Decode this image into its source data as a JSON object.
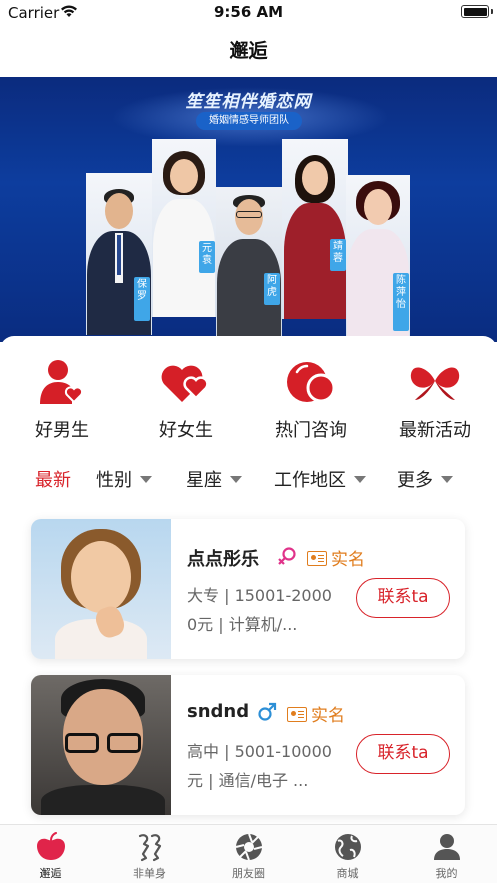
{
  "status_bar": {
    "carrier": "Carrier",
    "time": "9:56 AM"
  },
  "nav": {
    "title": "邂逅"
  },
  "banner": {
    "title": "笙笙相伴婚恋网",
    "subtitle": "婚姻情感导师团队",
    "mentors": [
      "保罗",
      "元袁",
      "阿虎",
      "靖蓉",
      "陈萍怡"
    ]
  },
  "categories": [
    {
      "label": "好男生",
      "icon": "male-user-heart-icon"
    },
    {
      "label": "好女生",
      "icon": "double-heart-icon"
    },
    {
      "label": "热门咨询",
      "icon": "bubble-circles-icon"
    },
    {
      "label": "最新活动",
      "icon": "ribbon-hearts-icon"
    }
  ],
  "filters": [
    {
      "label": "最新",
      "active": true
    },
    {
      "label": "性别",
      "dropdown": true
    },
    {
      "label": "星座",
      "dropdown": true
    },
    {
      "label": "工作地区",
      "dropdown": true
    },
    {
      "label": "更多",
      "dropdown": true
    }
  ],
  "users": [
    {
      "name": "点点彤乐",
      "gender": "female",
      "verified_label": "实名",
      "info": "大专 | 15001-20000元 | 计算机/...",
      "contact_label": "联系ta"
    },
    {
      "name": "sndnd",
      "gender": "male",
      "verified_label": "实名",
      "info": "高中 | 5001-10000元 | 通信/电子 ...",
      "contact_label": "联系ta"
    }
  ],
  "tabbar": [
    {
      "label": "邂逅",
      "icon": "heart-apple-icon",
      "active": true
    },
    {
      "label": "非单身",
      "icon": "couple-icon"
    },
    {
      "label": "朋友圈",
      "icon": "aperture-icon"
    },
    {
      "label": "商城",
      "icon": "planet-icon"
    },
    {
      "label": "我的",
      "icon": "user-icon"
    }
  ],
  "colors": {
    "accent": "#d8232a",
    "verify": "#e07d1e",
    "male": "#2d8fd6",
    "female": "#e0338a",
    "banner_bg": "#0d3d9e"
  }
}
